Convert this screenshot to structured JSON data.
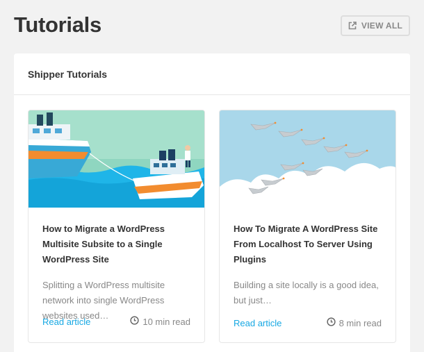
{
  "header": {
    "title": "Tutorials",
    "view_all_label": "VIEW ALL",
    "view_all_icon": "external-link-icon"
  },
  "panel": {
    "title": "Shipper Tutorials"
  },
  "tutorials": [
    {
      "title": "How to Migrate a WordPress Multisite Subsite to a Single WordPress Site",
      "excerpt": "Splitting a WordPress multisite network into single WordPress websites used…",
      "link_label": "Read article",
      "read_time": "10 min read",
      "image": "ships-illustration"
    },
    {
      "title": "How To Migrate A WordPress Site From Localhost To Server Using Plugins",
      "excerpt": "Building a site locally is a good idea, but just…",
      "link_label": "Read article",
      "read_time": "8 min read",
      "image": "geese-illustration"
    }
  ],
  "colors": {
    "background": "#f2f2f2",
    "panel": "#ffffff",
    "link": "#17a8e3",
    "muted_text": "#888888",
    "title_text": "#333333"
  }
}
